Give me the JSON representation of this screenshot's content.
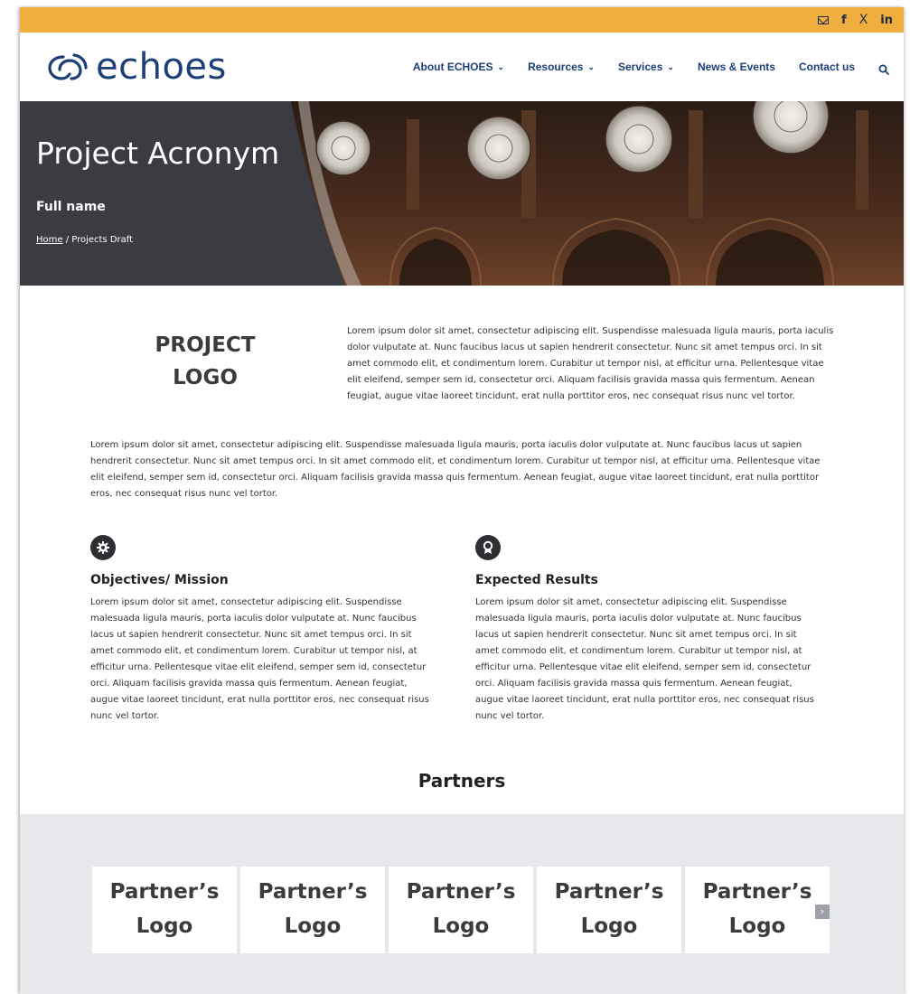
{
  "topbar": {
    "socials": [
      {
        "icon": "mail-icon",
        "label": ""
      },
      {
        "icon": "facebook-icon",
        "label": "f"
      },
      {
        "icon": "x-icon",
        "label": "X"
      },
      {
        "icon": "linkedin-icon",
        "label": "in"
      }
    ],
    "color": "#f0ae3f"
  },
  "header": {
    "logo_text": "echoes",
    "brand_color": "#1c3f76",
    "nav": [
      {
        "label": "About ECHOES",
        "dropdown": true
      },
      {
        "label": "Resources",
        "dropdown": true
      },
      {
        "label": "Services",
        "dropdown": true
      },
      {
        "label": "News & Events",
        "dropdown": false
      },
      {
        "label": "Contact us",
        "dropdown": false
      }
    ]
  },
  "hero": {
    "title": "Project Acronym",
    "subtitle": "Full name",
    "breadcrumb_home": "Home",
    "breadcrumb_current": " / Projects Draft"
  },
  "intro": {
    "logo_line1": "PROJECT",
    "logo_line2": "LOGO",
    "text": "Lorem ipsum dolor sit amet, consectetur adipiscing elit. Suspendisse malesuada ligula mauris, porta iaculis dolor vulputate at. Nunc faucibus lacus ut sapien hendrerit consectetur. Nunc sit amet tempus orci. In sit amet commodo elit, et condimentum lorem. Curabitur ut tempor nisl, at efficitur urna. Pellentesque vitae elit eleifend, semper sem id, consectetur orci. Aliquam facilisis gravida massa quis fermentum. Aenean feugiat, augue vitae laoreet tincidunt, erat nulla porttitor eros, nec consequat risus nunc vel tortor."
  },
  "body_text": "Lorem ipsum dolor sit amet, consectetur adipiscing elit. Suspendisse malesuada ligula mauris, porta iaculis dolor vulputate at. Nunc faucibus lacus ut sapien hendrerit consectetur. Nunc sit amet tempus orci. In sit amet commodo elit, et condimentum lorem. Curabitur ut tempor nisl, at efficitur urna. Pellentesque vitae elit eleifend, semper sem id, consectetur orci. Aliquam facilisis gravida massa quis fermentum. Aenean feugiat, augue vitae laoreet tincidunt, erat nulla porttitor eros, nec consequat risus nunc vel tortor.",
  "sections": [
    {
      "icon": "gear-icon",
      "title": "Objectives/ Mission",
      "text": "Lorem ipsum dolor sit amet, consectetur adipiscing elit. Suspendisse malesuada ligula mauris, porta iaculis dolor vulputate at. Nunc faucibus lacus ut sapien hendrerit consectetur. Nunc sit amet tempus orci. In sit amet commodo elit, et condimentum lorem. Curabitur ut tempor nisl, at efficitur urna. Pellentesque vitae elit eleifend, semper sem id, consectetur orci. Aliquam facilisis gravida massa quis fermentum. Aenean feugiat, augue vitae laoreet tincidunt, erat nulla porttitor eros, nec consequat risus nunc vel tortor."
    },
    {
      "icon": "award-icon",
      "title": "Expected Results",
      "text": "Lorem ipsum dolor sit amet, consectetur adipiscing elit. Suspendisse malesuada ligula mauris, porta iaculis dolor vulputate at. Nunc faucibus lacus ut sapien hendrerit consectetur. Nunc sit amet tempus orci. In sit amet commodo elit, et condimentum lorem. Curabitur ut tempor nisl, at efficitur urna. Pellentesque vitae elit eleifend, semper sem id, consectetur orci. Aliquam facilisis gravida massa quis fermentum. Aenean feugiat, augue vitae laoreet tincidunt, erat nulla porttitor eros, nec consequat risus nunc vel tortor."
    }
  ],
  "partners": {
    "title": "Partners",
    "cards": [
      {
        "line1": "Partner’s",
        "line2": "Logo"
      },
      {
        "line1": "Partner’s",
        "line2": "Logo"
      },
      {
        "line1": "Partner’s",
        "line2": "Logo"
      },
      {
        "line1": "Partner’s",
        "line2": "Logo"
      },
      {
        "line1": "Partner’s",
        "line2": "Logo"
      }
    ],
    "prev_icon": "chevron-left-icon",
    "next_icon": "chevron-right-icon"
  }
}
